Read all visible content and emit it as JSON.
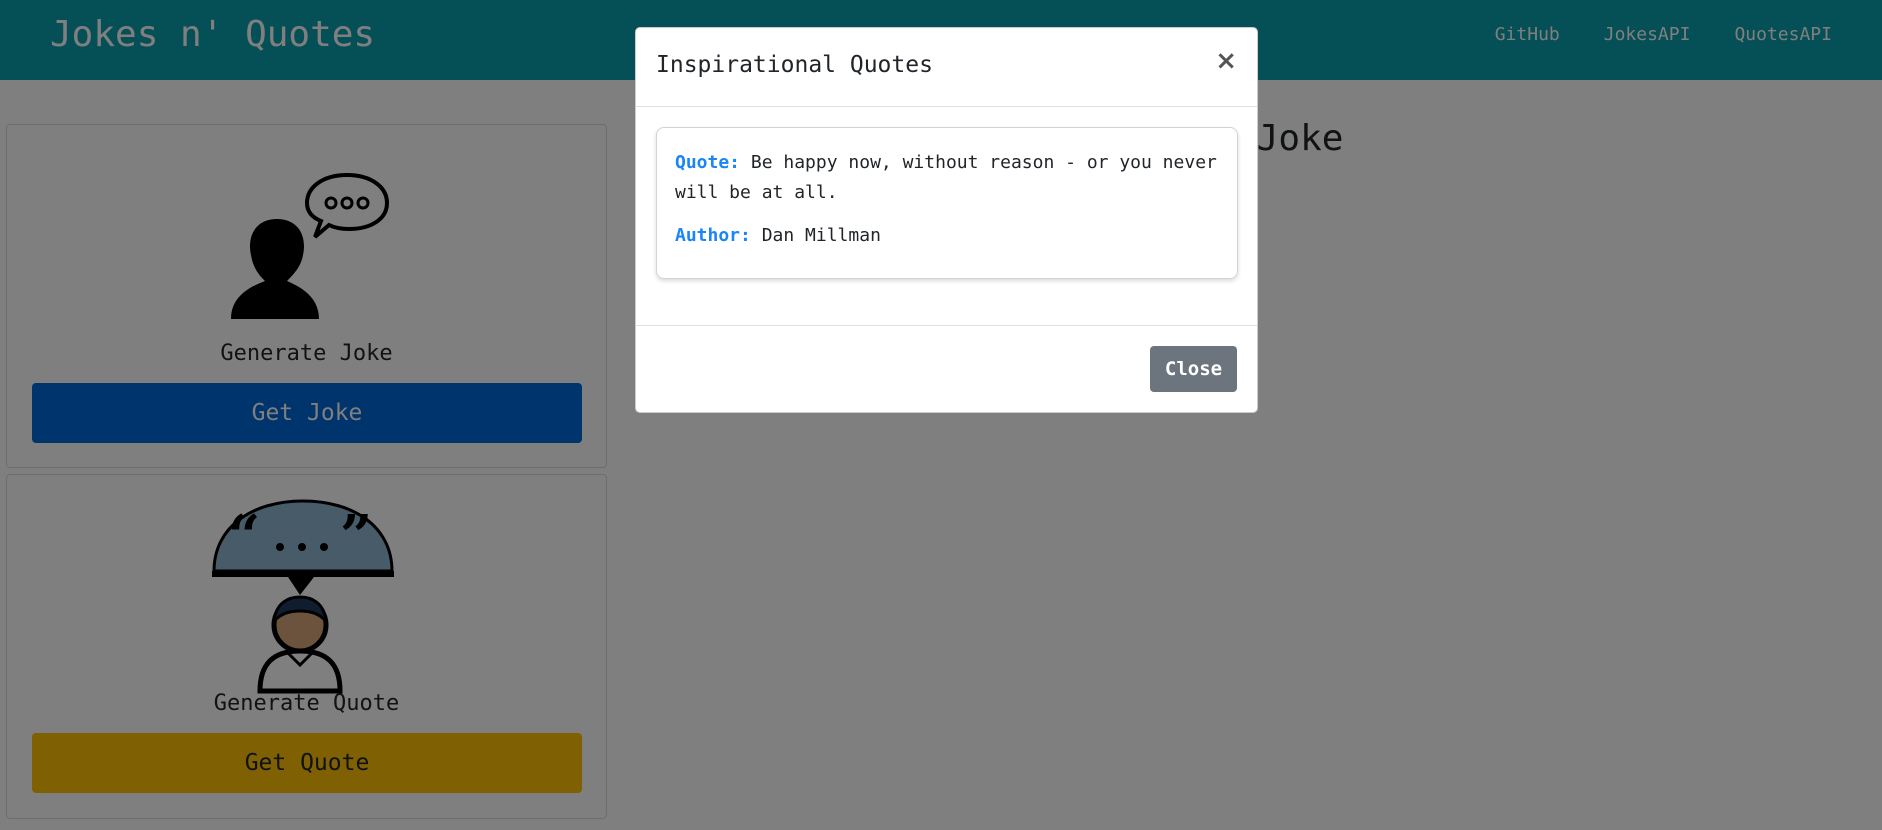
{
  "navbar": {
    "brand": "Jokes n' Quotes",
    "links": [
      "GitHub",
      "JokesAPI",
      "QuotesAPI"
    ]
  },
  "joke_card": {
    "title": "Generate Joke",
    "button_label": "Get Joke",
    "icon": "person-speech-bubble-icon"
  },
  "quote_card": {
    "title": "Generate Quote",
    "button_label": "Get Quote",
    "icon": "person-quote-bubble-icon"
  },
  "main": {
    "heading": "Generated Joke"
  },
  "modal": {
    "title": "Inspirational Quotes",
    "close_symbol": "×",
    "quote_label": "Quote:",
    "quote_text": "Be happy now, without reason - or you never will be at all.",
    "author_label": "Author:",
    "author_text": "Dan Millman",
    "close_button_label": "Close"
  },
  "colors": {
    "navbar": "#0a9fad",
    "joke_button": "#0069d9",
    "quote_button": "#ffc107",
    "label_accent": "#1a86f5",
    "close_button": "#6c757d"
  }
}
